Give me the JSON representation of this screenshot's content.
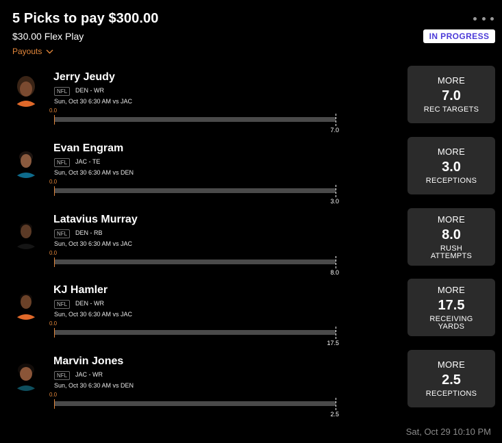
{
  "header": {
    "title": "5 Picks to pay $300.00",
    "subtitle": "$30.00 Flex Play",
    "payouts_label": "Payouts",
    "status": "IN PROGRESS"
  },
  "picks": [
    {
      "name": "Jerry Jeudy",
      "league": "NFL",
      "team_pos": "DEN - WR",
      "game": "Sun, Oct 30 6:30 AM  vs JAC",
      "current": "0.0",
      "target": "7.0",
      "direction": "MORE",
      "line": "7.0",
      "stat": "REC TARGETS",
      "progress": 0.0
    },
    {
      "name": "Evan Engram",
      "league": "NFL",
      "team_pos": "JAC - TE",
      "game": "Sun, Oct 30 6:30 AM  vs DEN",
      "current": "0.0",
      "target": "3.0",
      "direction": "MORE",
      "line": "3.0",
      "stat": "RECEPTIONS",
      "progress": 0.0
    },
    {
      "name": "Latavius Murray",
      "league": "NFL",
      "team_pos": "DEN - RB",
      "game": "Sun, Oct 30 6:30 AM  vs JAC",
      "current": "0.0",
      "target": "8.0",
      "direction": "MORE",
      "line": "8.0",
      "stat": "RUSH ATTEMPTS",
      "progress": 0.0
    },
    {
      "name": "KJ Hamler",
      "league": "NFL",
      "team_pos": "DEN - WR",
      "game": "Sun, Oct 30 6:30 AM  vs JAC",
      "current": "0.0",
      "target": "17.5",
      "direction": "MORE",
      "line": "17.5",
      "stat": "RECEIVING YARDS",
      "progress": 0.0
    },
    {
      "name": "Marvin Jones",
      "league": "NFL",
      "team_pos": "JAC - WR",
      "game": "Sun, Oct 30 6:30 AM  vs DEN",
      "current": "0.0",
      "target": "2.5",
      "direction": "MORE",
      "line": "2.5",
      "stat": "RECEPTIONS",
      "progress": 0.0
    }
  ],
  "footer": {
    "timestamp": "Sat, Oct 29 10:10 PM"
  },
  "colors": {
    "accent_orange": "#e2863a",
    "status_purple": "#4b3ad8",
    "card_bg": "#2b2b2b",
    "bar_bg": "#4a4a4a"
  }
}
